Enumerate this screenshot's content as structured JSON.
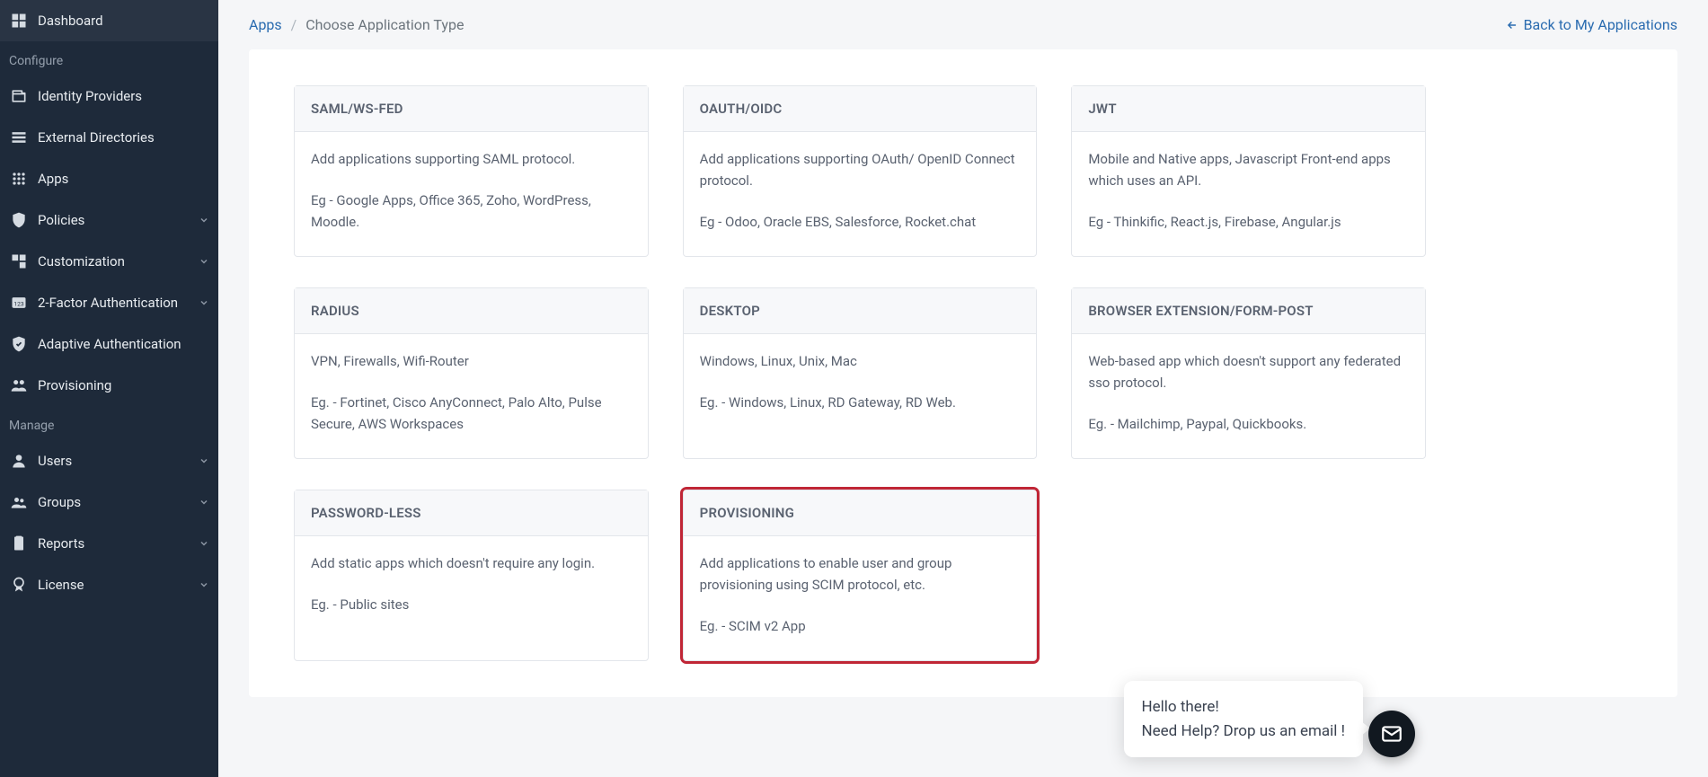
{
  "sidebar": {
    "items_top": [
      {
        "id": "dashboard",
        "label": "Dashboard",
        "icon": "dashboard"
      }
    ],
    "section_configure": "Configure",
    "items_configure": [
      {
        "id": "identity-providers",
        "label": "Identity Providers",
        "icon": "idp",
        "expandable": false
      },
      {
        "id": "external-directories",
        "label": "External Directories",
        "icon": "directories",
        "expandable": false
      },
      {
        "id": "apps",
        "label": "Apps",
        "icon": "apps",
        "expandable": false
      },
      {
        "id": "policies",
        "label": "Policies",
        "icon": "policies",
        "expandable": true
      },
      {
        "id": "customization",
        "label": "Customization",
        "icon": "customization",
        "expandable": true
      },
      {
        "id": "two-factor",
        "label": "2-Factor Authentication",
        "icon": "twofa",
        "expandable": true
      },
      {
        "id": "adaptive-auth",
        "label": "Adaptive Authentication",
        "icon": "adaptive",
        "expandable": false
      },
      {
        "id": "provisioning",
        "label": "Provisioning",
        "icon": "provisioning",
        "expandable": false
      }
    ],
    "section_manage": "Manage",
    "items_manage": [
      {
        "id": "users",
        "label": "Users",
        "icon": "users",
        "expandable": true
      },
      {
        "id": "groups",
        "label": "Groups",
        "icon": "groups",
        "expandable": true
      },
      {
        "id": "reports",
        "label": "Reports",
        "icon": "reports",
        "expandable": true
      },
      {
        "id": "license",
        "label": "License",
        "icon": "license",
        "expandable": true
      }
    ]
  },
  "breadcrumb": {
    "root": "Apps",
    "current": "Choose Application Type"
  },
  "backlink": "Back to My Applications",
  "cards": [
    {
      "id": "saml",
      "title": "SAML/WS-FED",
      "desc": "Add applications supporting SAML protocol.",
      "examples": "Eg - Google Apps, Office 365, Zoho, WordPress, Moodle.",
      "highlight": false
    },
    {
      "id": "oauth",
      "title": "OAUTH/OIDC",
      "desc": "Add applications supporting OAuth/ OpenID Connect protocol.",
      "examples": "Eg - Odoo, Oracle EBS, Salesforce, Rocket.chat",
      "highlight": false
    },
    {
      "id": "jwt",
      "title": "JWT",
      "desc": "Mobile and Native apps, Javascript Front-end apps which uses an API.",
      "examples": "Eg - Thinkific, React.js, Firebase, Angular.js",
      "highlight": false
    },
    {
      "id": "radius",
      "title": "RADIUS",
      "desc": "VPN, Firewalls, Wifi-Router",
      "examples": "Eg. - Fortinet, Cisco AnyConnect, Palo Alto, Pulse Secure, AWS Workspaces",
      "highlight": false
    },
    {
      "id": "desktop",
      "title": "DESKTOP",
      "desc": "Windows, Linux, Unix, Mac",
      "examples": "Eg. - Windows, Linux, RD Gateway, RD Web.",
      "highlight": false
    },
    {
      "id": "browser-ext",
      "title": "BROWSER EXTENSION/FORM-POST",
      "desc": "Web-based app which doesn't support any federated sso protocol.",
      "examples": "Eg. - Mailchimp, Paypal, Quickbooks.",
      "highlight": false
    },
    {
      "id": "passwordless",
      "title": "PASSWORD-LESS",
      "desc": "Add static apps which doesn't require any login.",
      "examples": "Eg. - Public sites",
      "highlight": false
    },
    {
      "id": "provisioning-card",
      "title": "PROVISIONING",
      "desc": "Add applications to enable user and group provisioning using SCIM protocol, etc.",
      "examples": "Eg. - SCIM v2 App",
      "highlight": true
    }
  ],
  "chat": {
    "line1": "Hello there!",
    "line2": "Need Help? Drop us an email !"
  }
}
